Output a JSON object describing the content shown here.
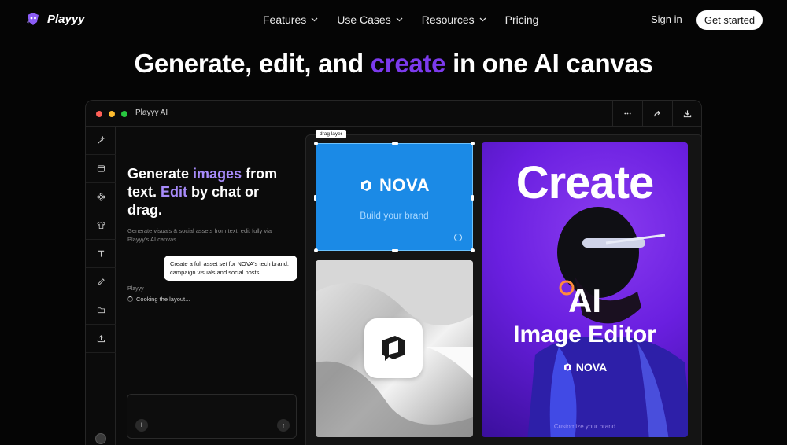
{
  "nav": {
    "brand": "Playyy",
    "menu": [
      {
        "label": "Features",
        "has_dropdown": true
      },
      {
        "label": "Use Cases",
        "has_dropdown": true
      },
      {
        "label": "Resources",
        "has_dropdown": true
      },
      {
        "label": "Pricing",
        "has_dropdown": false
      }
    ],
    "sign_in": "Sign in",
    "get_started": "Get started"
  },
  "hero": {
    "title_part1": "Generate, edit, and ",
    "title_accent": "create",
    "title_part2": " in one AI canvas",
    "accent_color": "#7c3aed"
  },
  "window": {
    "title": "Playyy AI",
    "toolbar_buttons": [
      "more-icon",
      "share-icon",
      "download-icon"
    ],
    "tools": [
      "magic-wand-icon",
      "template-icon",
      "elements-icon",
      "shirt-icon",
      "text-icon",
      "pen-icon",
      "folder-icon",
      "upload-icon"
    ],
    "chat": {
      "heading_1": "Generate ",
      "heading_hl1": "images",
      "heading_2": " from text. ",
      "heading_hl2": "Edit",
      "heading_3": " by chat or drag.",
      "subtext": "Generate visuals & social assets from text, edit fully via Playyy's AI canvas.",
      "user_message": "Create a full asset set for NOVA's tech brand: campaign visuals and social posts.",
      "bot_name": "Playyy",
      "bot_status": "Cooking the layout...",
      "add_icon": "+",
      "send_icon": "↑"
    },
    "canvas": {
      "drag_label": "drag layer",
      "blue_card": {
        "brand": "NOVA",
        "tagline": "Build your brand",
        "color": "#1b8ae6"
      },
      "purple_card": {
        "headline": "Create",
        "big": "AI",
        "sub": "Image Editor",
        "brand": "NOVA",
        "footer": "Customize your brand",
        "color": "#6a1fe0"
      }
    }
  }
}
